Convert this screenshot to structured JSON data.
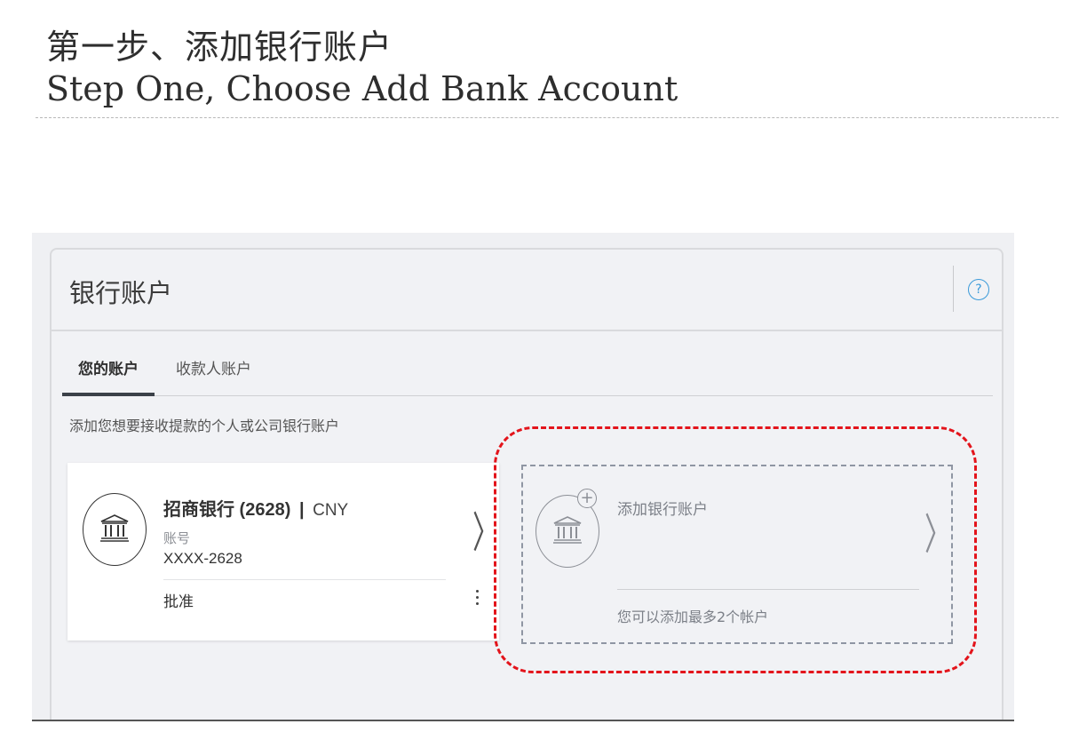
{
  "slide": {
    "title_cn": "第一步、添加银行账户",
    "title_en": "Step One, Choose Add Bank Account"
  },
  "panel": {
    "title": "银行账户",
    "help_icon": "?"
  },
  "tabs": [
    {
      "label": "您的账户",
      "active": true
    },
    {
      "label": "收款人账户",
      "active": false
    }
  ],
  "instruction": "添加您想要接收提款的个人或公司银行账户",
  "account_card": {
    "bank_name": "招商银行 (2628)",
    "separator": "|",
    "currency": "CNY",
    "number_label": "账号",
    "number": "XXXX-2628",
    "status": "批准",
    "icon": "bank-icon"
  },
  "add_card": {
    "title": "添加银行账户",
    "note": "您可以添加最多2个帐户",
    "icon": "bank-add-icon",
    "plus": "+"
  },
  "colors": {
    "highlight": "#e3141b",
    "help": "#3a9ad9",
    "panel_bg": "#f1f2f5"
  }
}
